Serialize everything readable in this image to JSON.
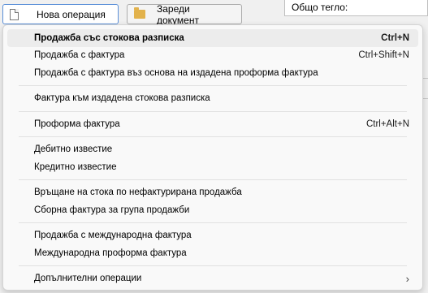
{
  "toolbar": {
    "new_operation": "Нова операция",
    "load_document": "Зареди документ"
  },
  "weight": {
    "label": "Общо тегло:"
  },
  "menu": {
    "items": [
      {
        "label": "Продажба със стокова разписка",
        "shortcut": "Ctrl+N"
      },
      {
        "label": "Продажба с фактура",
        "shortcut": "Ctrl+Shift+N"
      },
      {
        "label": "Продажба с фактура въз основа на издадена проформа фактура",
        "shortcut": ""
      },
      {
        "label": "Фактура към издадена стокова разписка",
        "shortcut": ""
      },
      {
        "label": "Проформа фактура",
        "shortcut": "Ctrl+Alt+N"
      },
      {
        "label": "Дебитно известие",
        "shortcut": ""
      },
      {
        "label": "Кредитно известие",
        "shortcut": ""
      },
      {
        "label": "Връщане на стока по нефактурирана продажба",
        "shortcut": ""
      },
      {
        "label": "Сборна фактура за група продажби",
        "shortcut": ""
      },
      {
        "label": "Продажба с международна фактура",
        "shortcut": ""
      },
      {
        "label": "Международна проформа фактура",
        "shortcut": ""
      },
      {
        "label": "Допълнителни операции",
        "submenu_icon": "chevron-right-icon"
      }
    ]
  }
}
